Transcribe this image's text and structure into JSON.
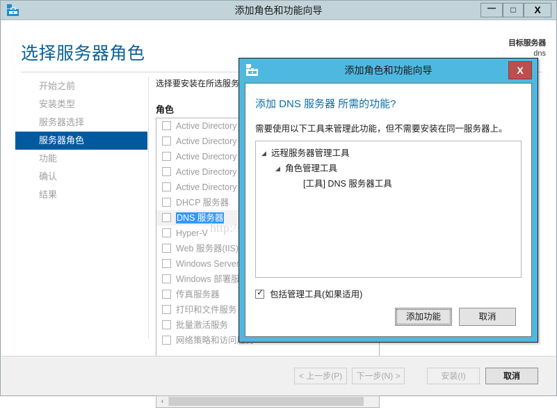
{
  "main_window": {
    "title": "添加角色和功能向导",
    "icon": "toolbox-icon",
    "buttons": {
      "minimize": "—",
      "maximize": "□",
      "close": "X"
    },
    "page_heading": "选择服务器角色",
    "target_server": {
      "label": "目标服务器",
      "name": "dns"
    },
    "nav": {
      "items": [
        {
          "label": "开始之前",
          "selected": false
        },
        {
          "label": "安装类型",
          "selected": false
        },
        {
          "label": "服务器选择",
          "selected": false
        },
        {
          "label": "服务器角色",
          "selected": true
        },
        {
          "label": "功能",
          "selected": false
        },
        {
          "label": "确认",
          "selected": false
        },
        {
          "label": "结果",
          "selected": false
        }
      ]
    },
    "content": {
      "description": "选择要安装在所选服务器上的一个或多个角色。",
      "roles_label": "角色",
      "roles": [
        {
          "label": "Active Directory Rights Management 服务",
          "checked": false,
          "selected": false
        },
        {
          "label": "Active Directory 联合身份验证服务",
          "checked": false,
          "selected": false
        },
        {
          "label": "Active Directory 轻型目录服务",
          "checked": false,
          "selected": false
        },
        {
          "label": "Active Directory 证书服务",
          "checked": false,
          "selected": false
        },
        {
          "label": "Active Directory 域服务",
          "checked": false,
          "selected": false
        },
        {
          "label": "DHCP 服务器",
          "checked": false,
          "selected": false
        },
        {
          "label": "DNS 服务器",
          "checked": false,
          "selected": true
        },
        {
          "label": "Hyper-V",
          "checked": false,
          "selected": false
        },
        {
          "label": "Web 服务器(IIS)",
          "checked": false,
          "selected": false
        },
        {
          "label": "Windows Server Update Services",
          "checked": false,
          "selected": false
        },
        {
          "label": "Windows 部署服务",
          "checked": false,
          "selected": false
        },
        {
          "label": "传真服务器",
          "checked": false,
          "selected": false
        },
        {
          "label": "打印和文件服务",
          "checked": false,
          "selected": false
        },
        {
          "label": "批量激活服务",
          "checked": false,
          "selected": false
        },
        {
          "label": "网络策略和访问服务",
          "checked": false,
          "selected": false
        }
      ],
      "scroll_left_arrow": "‹"
    },
    "watermark": "http://blog.csdn.net/ronsarah",
    "footer": {
      "previous": "< 上一步(P)",
      "next": "下一步(N) >",
      "install": "安装(I)",
      "cancel": "取消"
    }
  },
  "dialog": {
    "title": "添加角色和功能向导",
    "icon": "toolbox-icon",
    "close_label": "X",
    "heading": "添加 DNS 服务器 所需的功能?",
    "subtext": "需要使用以下工具来管理此功能，但不需要安装在同一服务器上。",
    "tree": [
      {
        "label": "远程服务器管理工具",
        "level": 0,
        "arrow": "◢"
      },
      {
        "label": "角色管理工具",
        "level": 1,
        "arrow": "◢"
      },
      {
        "label": "[工具] DNS 服务器工具",
        "level": 2,
        "arrow": ""
      }
    ],
    "checkbox_label": "包括管理工具(如果适用)",
    "checkbox_checked": true,
    "add_button": "添加功能",
    "cancel_button": "取消"
  },
  "colors": {
    "title_bar": "#c3d3da",
    "nav_selected": "#015aa0",
    "heading_blue": "#0a6197",
    "dialog_frame": "#4fb8e0",
    "dialog_close_red": "#bc4f4f",
    "selection_blue": "#3399ff"
  }
}
